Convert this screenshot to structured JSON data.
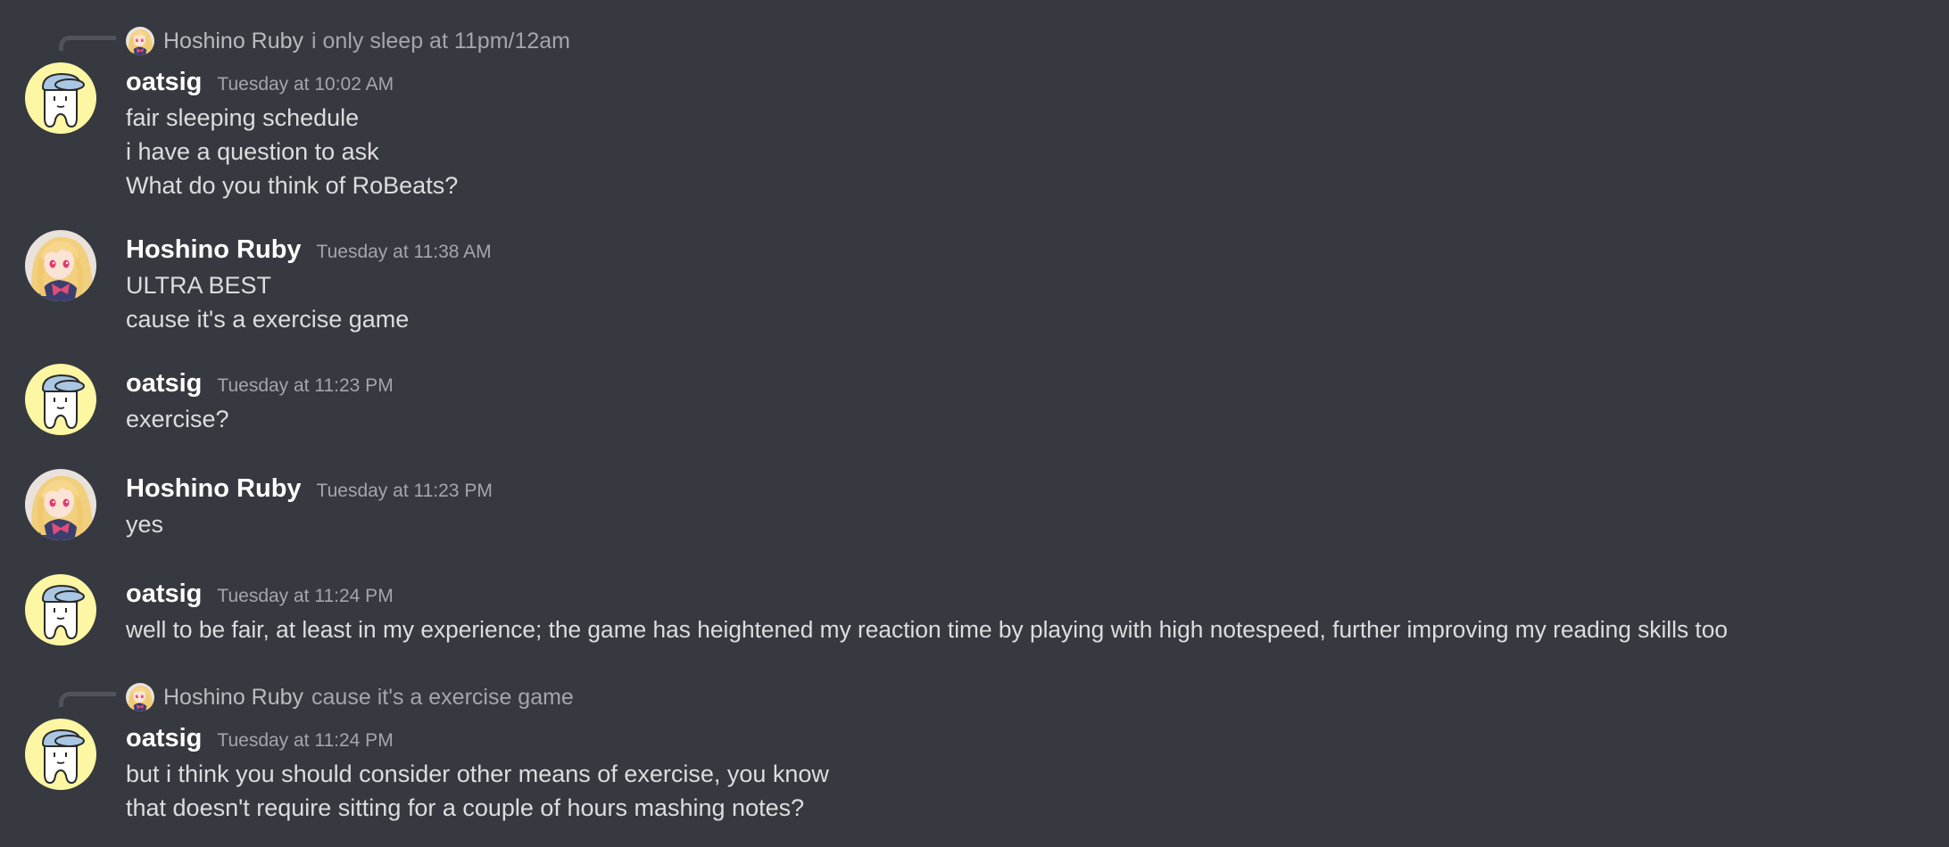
{
  "colors": {
    "background": "#36393f",
    "username": "#ffffff",
    "timestamp": "#a3a6aa",
    "message_text": "#dcddde",
    "reply_spine": "#4f545c",
    "oatsig_avatar_bg": "#fdf6a3",
    "oatsig_hat": "#a9c7e3"
  },
  "icons": {
    "oatsig_avatar": "tooth-with-cap-avatar",
    "ruby_avatar": "anime-girl-blonde-avatar"
  },
  "messages": [
    {
      "reply": {
        "author": "Hoshino Ruby",
        "text": "i only sleep at 11pm/12am"
      },
      "author": "oatsig",
      "timestamp": "Tuesday at 10:02 AM",
      "lines": [
        "fair sleeping schedule",
        "i have a question to ask",
        "What do you think of RoBeats?"
      ]
    },
    {
      "author": "Hoshino Ruby",
      "timestamp": "Tuesday at 11:38 AM",
      "lines": [
        "ULTRA BEST",
        "cause it's a exercise game"
      ]
    },
    {
      "author": "oatsig",
      "timestamp": "Tuesday at 11:23 PM",
      "lines": [
        "exercise?"
      ]
    },
    {
      "author": "Hoshino Ruby",
      "timestamp": "Tuesday at 11:23 PM",
      "lines": [
        "yes"
      ]
    },
    {
      "author": "oatsig",
      "timestamp": "Tuesday at 11:24 PM",
      "lines": [
        "well to be fair, at least in my experience; the game has heightened my reaction time by playing with high notespeed, further improving my reading skills too"
      ]
    },
    {
      "reply": {
        "author": "Hoshino Ruby",
        "text": "cause it's a exercise game"
      },
      "author": "oatsig",
      "timestamp": "Tuesday at 11:24 PM",
      "lines": [
        "but i think you should consider other means of exercise, you know",
        "that doesn't require sitting for a couple of hours mashing notes?"
      ]
    }
  ]
}
